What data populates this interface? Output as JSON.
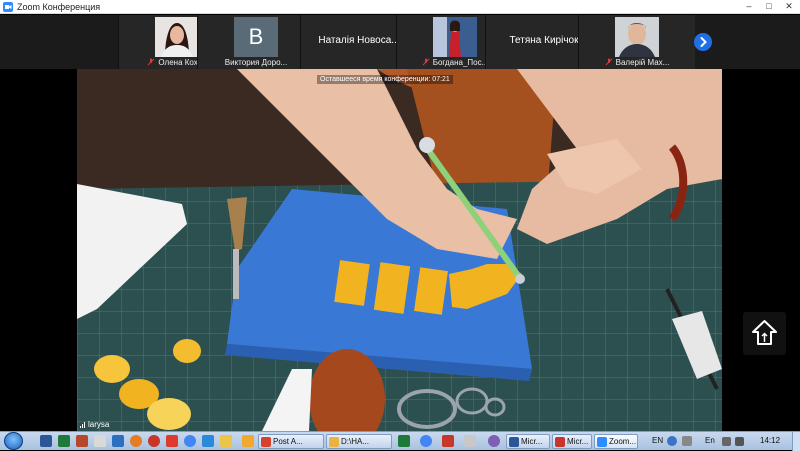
{
  "window": {
    "title": "Zoom Конференция",
    "controls": [
      "–",
      "□",
      "✕"
    ]
  },
  "gallery": {
    "participants": [
      {
        "name": "Олена Кохан",
        "type": "photo",
        "muted": true
      },
      {
        "name": "Виктория Доро...",
        "type": "letter",
        "letter": "B",
        "muted": false
      },
      {
        "name": "Наталія  Новоса...",
        "type": "name-only",
        "muted": false
      },
      {
        "name": "Богдана_Пос...",
        "type": "photo",
        "muted": true
      },
      {
        "name": "Тетяна Кирічок",
        "type": "name-only",
        "muted": false
      },
      {
        "name": "Валерій Мах...",
        "type": "photo",
        "muted": true
      }
    ],
    "next_icon": "chevron-right-icon"
  },
  "main_video": {
    "timer_text": "Оставшееся время конференции: 07:21",
    "speaker_name": "larysa",
    "share_icon": "share-screen-icon"
  },
  "taskbar": {
    "tasks": [
      {
        "label": "Post A...",
        "color": "#d9412b"
      },
      {
        "label": "D:\\HA...",
        "color": "#e8b341"
      },
      {
        "label": "Micr...",
        "color": "#2b5797"
      },
      {
        "label": "Micr...",
        "color": "#c7352b"
      },
      {
        "label": "Zoom...",
        "color": "#2d8cff"
      }
    ],
    "language": "EN",
    "language2": "En",
    "clock": "14:12"
  },
  "colors": {
    "zoom_blue": "#1f6fe5",
    "mat_green": "#2c5050",
    "foam_blue": "#3a78d6",
    "flower_yellow": "#f2b320"
  }
}
